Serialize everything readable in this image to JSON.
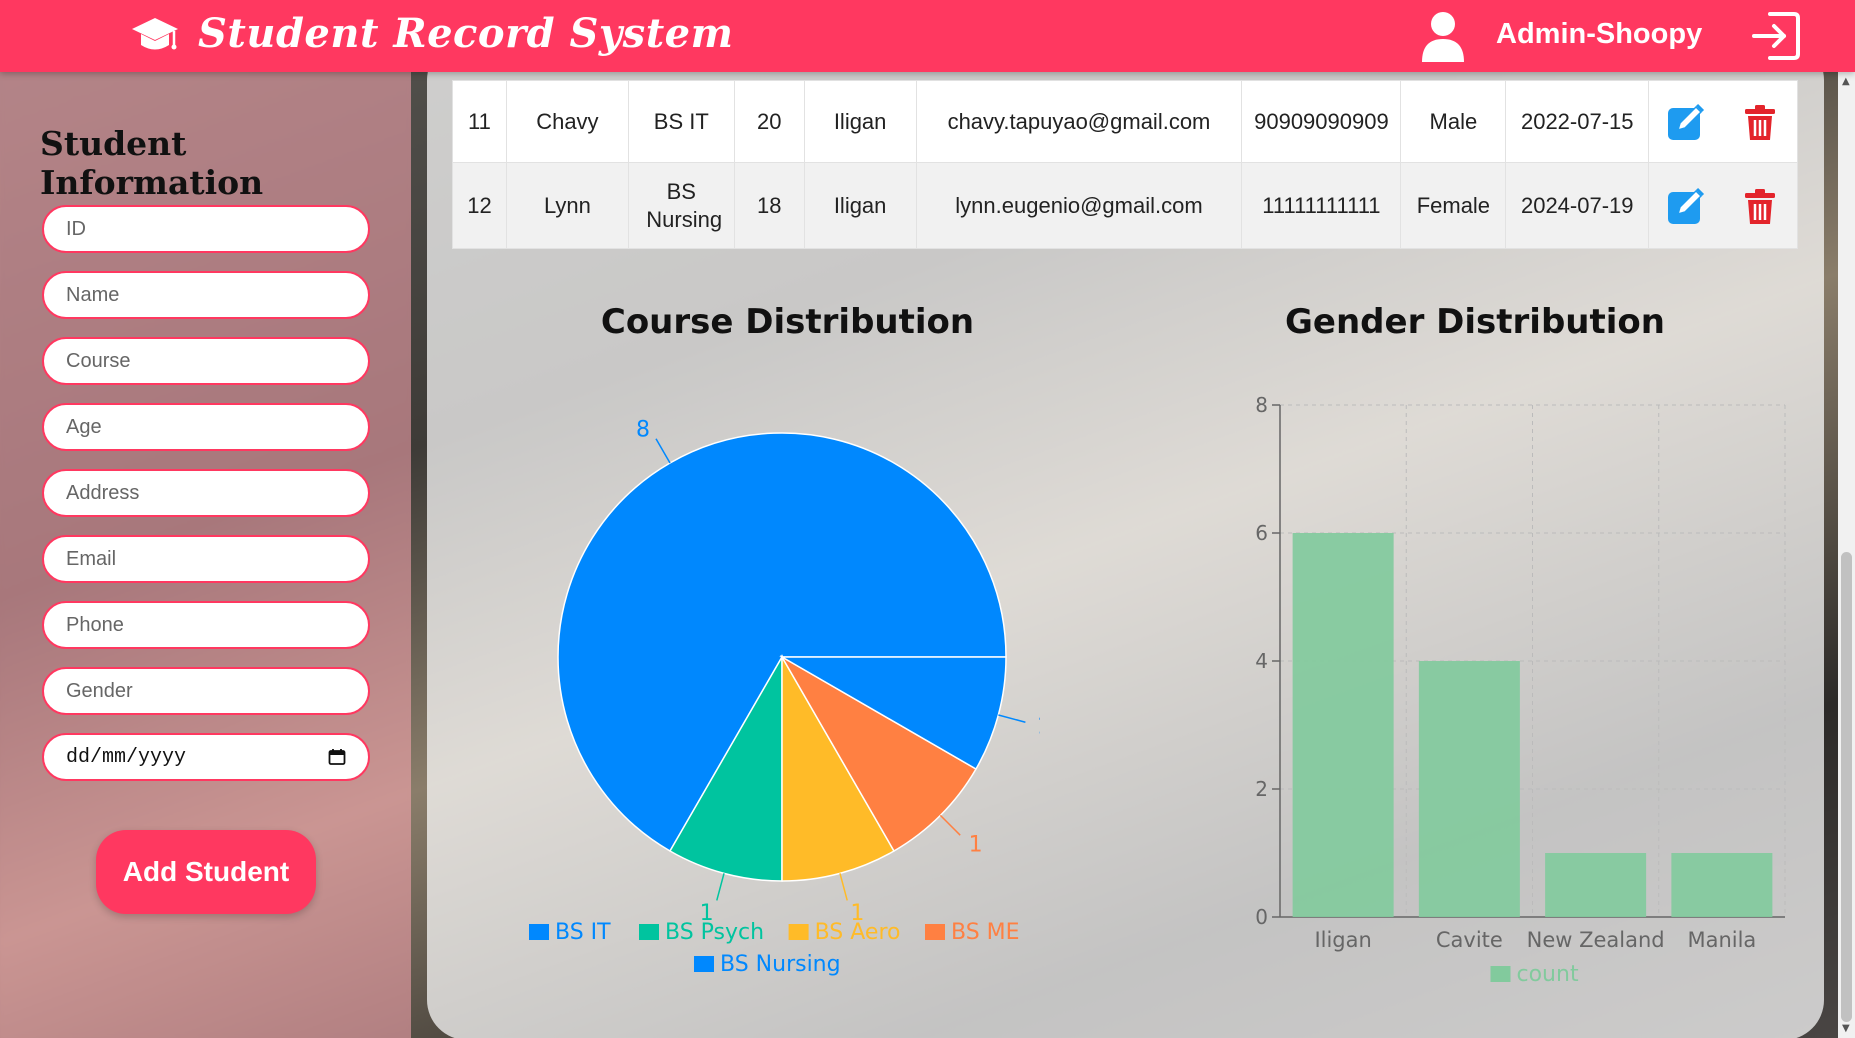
{
  "header": {
    "title": "Student Record System",
    "user_name": "Admin-Shoopy",
    "logo_icon": "graduation-cap-icon",
    "user_icon": "user-icon",
    "logout_icon": "logout-icon",
    "brand_color": "#ff3860"
  },
  "sidebar": {
    "title": "Student Information",
    "fields": {
      "id": "ID",
      "name": "Name",
      "course": "Course",
      "age": "Age",
      "address": "Address",
      "email": "Email",
      "phone": "Phone",
      "gender": "Gender"
    },
    "date_placeholder": "dd/mm/yyyy",
    "add_button": "Add Student"
  },
  "table": {
    "rows": [
      {
        "id": "11",
        "name": "Chavy",
        "course": "BS IT",
        "age": "20",
        "address": "Iligan",
        "email": "chavy.tapuyao@gmail.com",
        "phone": "90909090909",
        "gender": "Male",
        "date": "2022-07-15"
      },
      {
        "id": "12",
        "name": "Lynn",
        "course": "BS Nursing",
        "age": "18",
        "address": "Iligan",
        "email": "lynn.eugenio@gmail.com",
        "phone": "11111111111",
        "gender": "Female",
        "date": "2024-07-19"
      }
    ]
  },
  "chart_data": [
    {
      "type": "pie",
      "title": "Course Distribution",
      "categories": [
        "BS IT",
        "BS Psych",
        "BS Aero",
        "BS ME",
        "BS Nursing"
      ],
      "values": [
        8,
        1,
        1,
        1,
        1
      ],
      "colors": [
        "#0088fe",
        "#00c49f",
        "#ffbb28",
        "#ff8042",
        "#0088fe"
      ],
      "legend": "bottom"
    },
    {
      "type": "bar",
      "title": "Gender Distribution",
      "categories": [
        "Iligan",
        "Cavite",
        "New Zealand",
        "Manila"
      ],
      "series": [
        {
          "name": "count",
          "values": [
            6,
            4,
            1,
            1
          ]
        }
      ],
      "ylim": [
        0,
        8
      ],
      "yticks": [
        0,
        2,
        4,
        6,
        8
      ],
      "grid": true,
      "legend": "bottom",
      "color": "#82ca9d"
    }
  ]
}
